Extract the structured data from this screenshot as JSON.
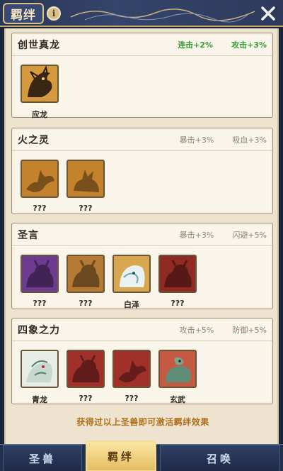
{
  "header": {
    "title": "羁绊",
    "info_symbol": "i"
  },
  "groups": [
    {
      "title": "创世真龙",
      "bonuses": [
        {
          "label": "连击+2%",
          "active": true
        },
        {
          "label": "攻击+3%",
          "active": true
        }
      ],
      "beasts": [
        {
          "name": "应龙",
          "color": "#c98a2f",
          "unlocked": true,
          "icon": "dragon-portrait"
        }
      ]
    },
    {
      "title": "火之灵",
      "bonuses": [
        {
          "label": "暴击+3%",
          "active": false
        },
        {
          "label": "吸血+3%",
          "active": false
        }
      ],
      "beasts": [
        {
          "name": "???",
          "color": "#c4822c",
          "unlocked": false,
          "icon": "bird-silhouette"
        },
        {
          "name": "???",
          "color": "#c4822c",
          "unlocked": false,
          "icon": "fox-silhouette"
        }
      ]
    },
    {
      "title": "圣言",
      "bonuses": [
        {
          "label": "暴击+3%",
          "active": false
        },
        {
          "label": "闪避+5%",
          "active": false
        }
      ],
      "beasts": [
        {
          "name": "???",
          "color": "#6d3b8f",
          "unlocked": false,
          "icon": "beast-silhouette"
        },
        {
          "name": "???",
          "color": "#b57a34",
          "unlocked": false,
          "icon": "beast-silhouette"
        },
        {
          "name": "白泽",
          "color": "#8fb7b9",
          "unlocked": true,
          "icon": "baize-portrait"
        },
        {
          "name": "???",
          "color": "#8f2a24",
          "unlocked": false,
          "icon": "beast-silhouette"
        }
      ]
    },
    {
      "title": "四象之力",
      "bonuses": [
        {
          "label": "攻击+5%",
          "active": false
        },
        {
          "label": "防御+5%",
          "active": false
        }
      ],
      "beasts": [
        {
          "name": "青龙",
          "color": "#c9d6d0",
          "unlocked": true,
          "icon": "azure-dragon-portrait"
        },
        {
          "name": "???",
          "color": "#a2302a",
          "unlocked": false,
          "icon": "beast-silhouette"
        },
        {
          "name": "???",
          "color": "#a2302a",
          "unlocked": false,
          "icon": "bird-silhouette"
        },
        {
          "name": "玄武",
          "color": "#7c8f83",
          "unlocked": true,
          "icon": "black-tortoise-portrait"
        }
      ]
    }
  ],
  "hint": "获得过以上圣兽即可激活羁绊效果",
  "tabs": [
    {
      "label": "圣兽",
      "active": false
    },
    {
      "label": "羁绊",
      "active": true
    },
    {
      "label": "召唤",
      "active": false
    }
  ]
}
